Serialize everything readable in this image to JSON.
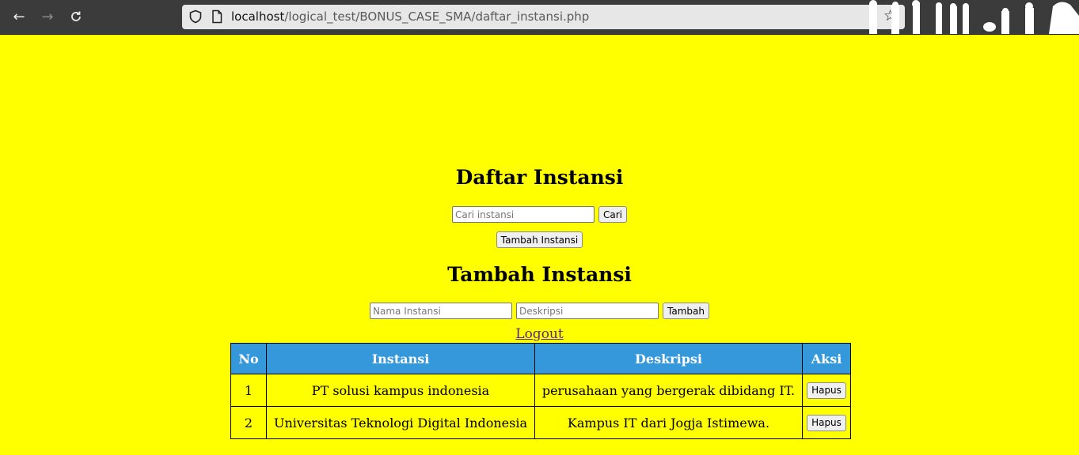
{
  "browser": {
    "url_host": "localhost",
    "url_path": "/logical_test/BONUS_CASE_SMA/daftar_instansi.php",
    "icons": [
      "back-arrow-icon",
      "forward-arrow-icon",
      "reload-icon",
      "shield-icon",
      "page-icon",
      "bookmark-star-icon"
    ]
  },
  "page": {
    "title": "Daftar Instansi",
    "search_placeholder": "Cari instansi",
    "search_button": "Cari",
    "add_toggle_button": "Tambah Instansi",
    "form_title": "Tambah Instansi",
    "name_placeholder": "Nama Instansi",
    "desc_placeholder": "Deskripsi",
    "add_button": "Tambah",
    "logout": "Logout"
  },
  "table": {
    "headers": [
      "No",
      "Instansi",
      "Deskripsi",
      "Aksi"
    ],
    "rows": [
      {
        "no": "1",
        "instansi": "PT solusi kampus indonesia",
        "deskripsi": "perusahaan yang bergerak dibidang IT.",
        "action": "Hapus"
      },
      {
        "no": "2",
        "instansi": "Universitas Teknologi Digital Indonesia",
        "deskripsi": "Kampus IT dari Jogja Istimewa.",
        "action": "Hapus"
      }
    ]
  },
  "colors": {
    "page_background": "#ffff00",
    "table_header": "#3498db",
    "toolbar": "#3b3b3b"
  }
}
